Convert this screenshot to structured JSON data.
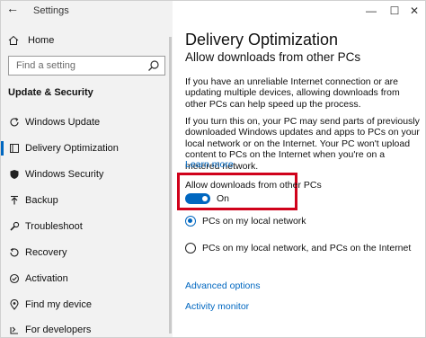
{
  "window": {
    "title": "Settings",
    "controls": {
      "minimize": "—",
      "maximize": "☐",
      "close": "✕"
    }
  },
  "sidebar": {
    "home_label": "Home",
    "search_placeholder": "Find a setting",
    "section_heading": "Update & Security",
    "items": [
      {
        "label": "Windows Update",
        "icon": "refresh-icon",
        "selected": false
      },
      {
        "label": "Delivery Optimization",
        "icon": "delivery-icon",
        "selected": true
      },
      {
        "label": "Windows Security",
        "icon": "shield-icon",
        "selected": false
      },
      {
        "label": "Backup",
        "icon": "backup-icon",
        "selected": false
      },
      {
        "label": "Troubleshoot",
        "icon": "wrench-icon",
        "selected": false
      },
      {
        "label": "Recovery",
        "icon": "recovery-icon",
        "selected": false
      },
      {
        "label": "Activation",
        "icon": "activation-icon",
        "selected": false
      },
      {
        "label": "Find my device",
        "icon": "find-device-icon",
        "selected": false
      },
      {
        "label": "For developers",
        "icon": "developers-icon",
        "selected": false
      }
    ]
  },
  "main": {
    "title": "Delivery Optimization",
    "subtitle": "Allow downloads from other PCs",
    "para1": "If you have an unreliable Internet connection or are updating multiple devices, allowing downloads from other PCs can help speed up the process.",
    "para2": "If you turn this on, your PC may send parts of previously downloaded Windows updates and apps to PCs on your local network or on the Internet. Your PC won't upload content to PCs on the Internet when you're on a metered network.",
    "learn_more": "Learn more",
    "toggle": {
      "label": "Allow downloads from other PCs",
      "state_text": "On",
      "on": true
    },
    "radio_options": [
      {
        "label": "PCs on my local network",
        "checked": true
      },
      {
        "label": "PCs on my local network, and PCs on the Internet",
        "checked": false
      }
    ],
    "links": {
      "advanced": "Advanced options",
      "activity": "Activity monitor"
    }
  },
  "colors": {
    "accent": "#0067c0",
    "highlight": "#d0021b",
    "sidebar_bg": "#f2f2f2"
  }
}
